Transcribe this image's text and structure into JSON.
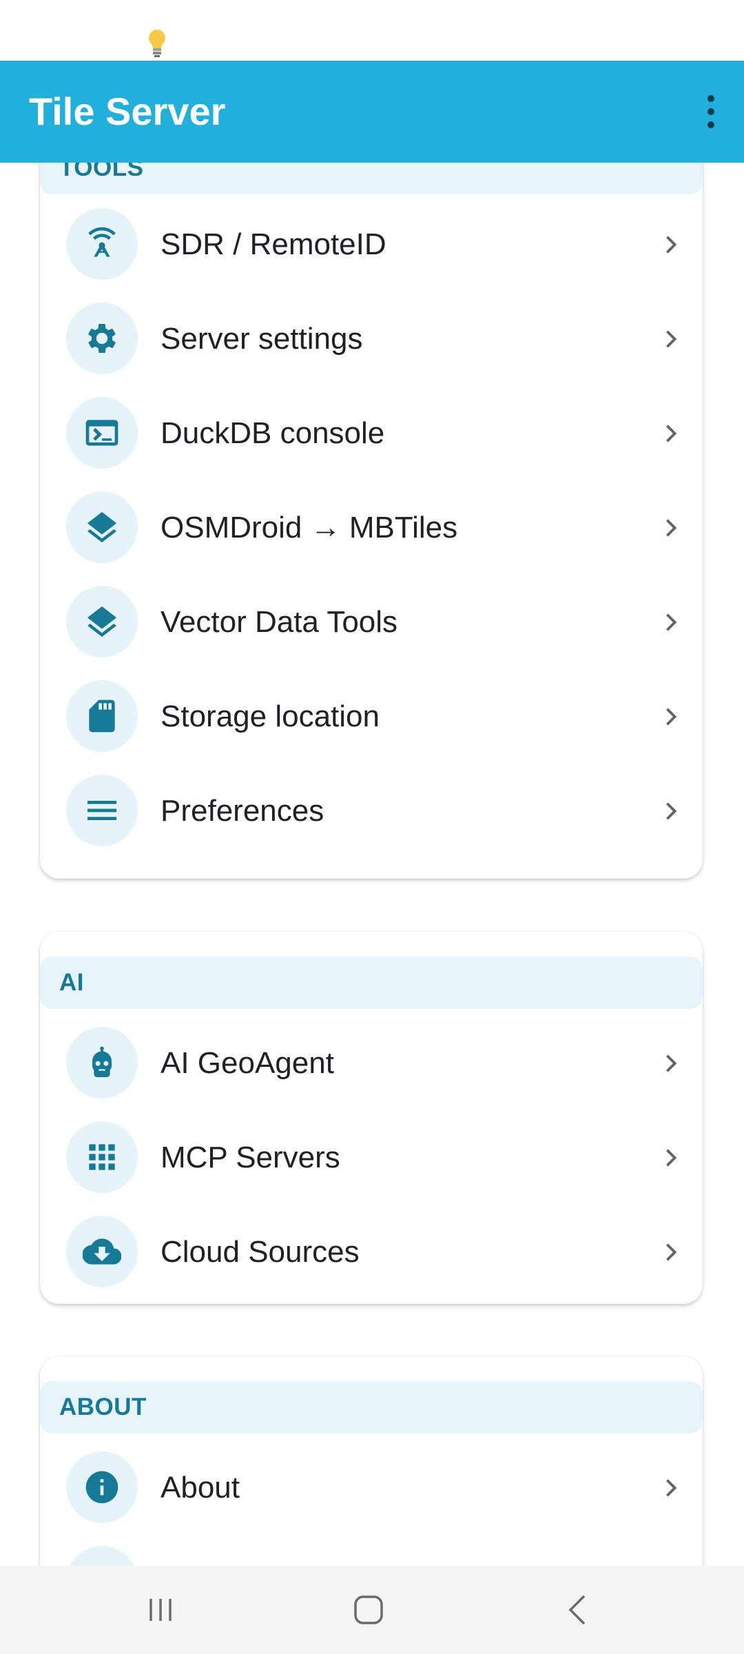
{
  "app_bar": {
    "title": "Tile Server",
    "overflow_icon": "more-vert-icon"
  },
  "colors": {
    "app_bar": "#21afdc",
    "accent": "#167a96",
    "section_header_bg": "#e8f4fb",
    "icon_bg": "#e6f3fa"
  },
  "sections": {
    "tools": {
      "header": "TOOLS",
      "items": [
        {
          "label": "SDR / RemoteID",
          "icon": "antenna-icon"
        },
        {
          "label": "Server settings",
          "icon": "gear-icon"
        },
        {
          "label": "DuckDB console",
          "icon": "terminal-icon"
        },
        {
          "label": "OSMDroid → MBTiles",
          "icon": "layers-icon"
        },
        {
          "label": "Vector Data Tools",
          "icon": "layers-icon"
        },
        {
          "label": "Storage location",
          "icon": "sd-card-icon"
        },
        {
          "label": "Preferences",
          "icon": "menu-icon"
        }
      ]
    },
    "ai": {
      "header": "AI",
      "items": [
        {
          "label": "AI GeoAgent",
          "icon": "robot-icon"
        },
        {
          "label": "MCP Servers",
          "icon": "grid-icon"
        },
        {
          "label": "Cloud Sources",
          "icon": "cloud-download-icon"
        }
      ]
    },
    "about": {
      "header": "ABOUT",
      "items": [
        {
          "label": "About",
          "icon": "info-icon"
        }
      ]
    }
  },
  "nav_bar": {
    "recents_icon": "recents-icon",
    "home_icon": "home-icon",
    "back_icon": "back-icon"
  }
}
